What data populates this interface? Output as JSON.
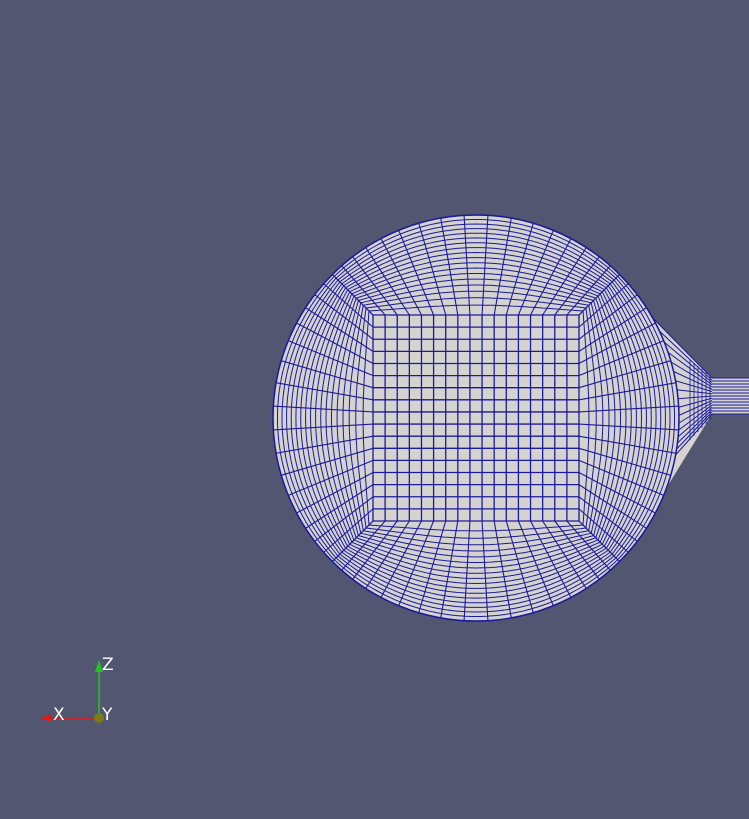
{
  "view": {
    "background_color": "#525670",
    "mesh_fill_color": "#d5d3d0",
    "mesh_line_color": "#1a1a9c"
  },
  "orientation_axes": {
    "x_label": "X",
    "y_label": "Y",
    "z_label": "Z",
    "x_color": "#e01919",
    "y_color": "#807a16",
    "z_color": "#22c322"
  }
}
